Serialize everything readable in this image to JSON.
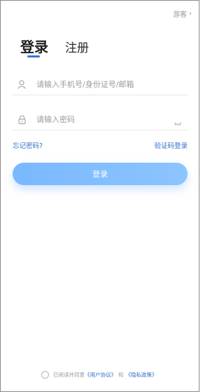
{
  "header": {
    "guest_label": "游客",
    "guest_chevron": "›"
  },
  "tabs": {
    "login": "登录",
    "register": "注册"
  },
  "form": {
    "account_placeholder": "请输入手机号/身份证号/邮箱",
    "account_value": "",
    "password_placeholder": "请输入密码",
    "password_value": "",
    "forgot_password": "忘记密码?",
    "sms_login": "验证码登录",
    "submit": "登录"
  },
  "agreement": {
    "prefix": "已阅读并同意",
    "user_agreement": "《用户协议》",
    "and": "和",
    "privacy_policy": "《隐私政策》",
    "checked": false
  },
  "colors": {
    "accent": "#2f7bd7",
    "link": "#2f6fc7",
    "button": "#7ab8ff"
  },
  "icons": {
    "account": "user-icon",
    "password": "lock-icon",
    "toggle": "eye-closed-icon"
  }
}
